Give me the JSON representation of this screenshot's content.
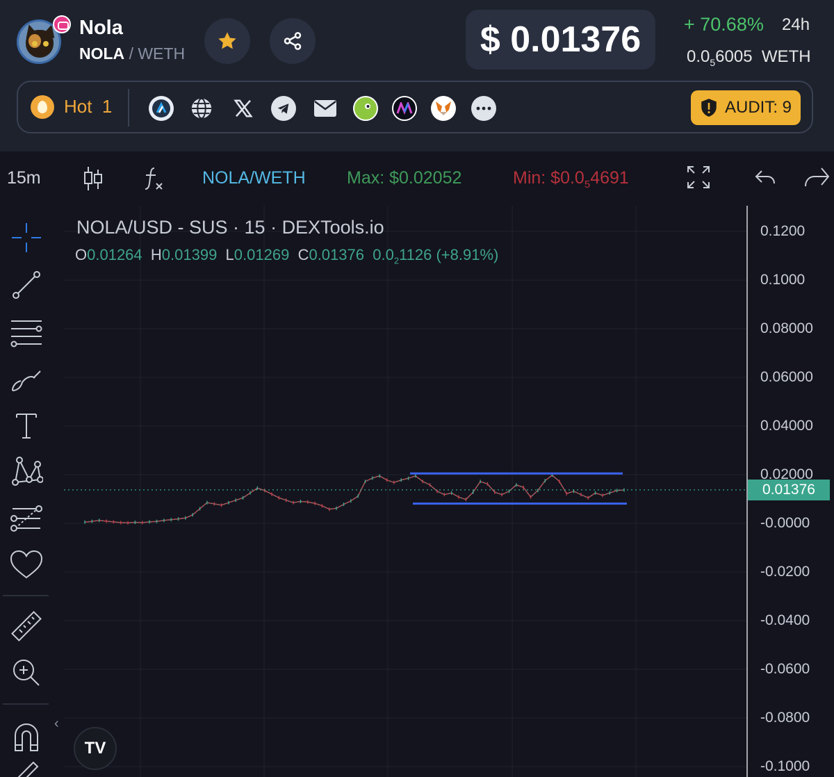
{
  "token": {
    "name": "Nola",
    "base": "NOLA",
    "separator": "/",
    "quote": "WETH",
    "logo_icon": "cat-token-logo",
    "chain_icon": "chain-badge-icon"
  },
  "price": {
    "usd": "$ 0.01376",
    "change_pct": "+ 70.68%",
    "change_period": "24h",
    "weth_prefix": "0.0",
    "weth_sub": "5",
    "weth_digits": "6005",
    "weth_unit": "WETH"
  },
  "links": {
    "hot_label": "Hot",
    "hot_rank": "1",
    "icons": [
      "arbitrum-icon",
      "website-icon",
      "x-icon",
      "telegram-icon",
      "email-icon",
      "coingecko-icon",
      "dextools-icon",
      "metamask-icon",
      "more-icon"
    ],
    "audit_label": "AUDIT: 9"
  },
  "toolbar": {
    "interval": "15m",
    "pair": "NOLA/WETH",
    "max_label": "Max: $0.02052",
    "min_prefix": "Min: $0.0",
    "min_sub": "5",
    "min_digits": "4691"
  },
  "chart": {
    "title": "NOLA/USD - SUS · 15 · DEXTools.io",
    "ohlc": {
      "o_label": "O",
      "o": "0.01264",
      "h_label": "H",
      "h": "0.01399",
      "l_label": "L",
      "l": "0.01269",
      "c_label": "C",
      "c": "0.01376",
      "chg_prefix": "0.0",
      "chg_sub": "2",
      "chg_digits": "1126",
      "chg_pct": "(+8.91%)"
    },
    "y_ticks": [
      "0.1200",
      "0.1000",
      "0.08000",
      "0.06000",
      "0.04000",
      "0.02000",
      "-0.0000",
      "-0.0200",
      "-0.0400",
      "-0.0600",
      "-0.0800",
      "-0.1000"
    ],
    "last_price": "0.01376",
    "tv_logo": "TV"
  },
  "chart_data": {
    "type": "line",
    "title": "NOLA/USD - SUS · 15 · DEXTools.io",
    "ylim": [
      -0.1,
      0.12
    ],
    "y_ticks": [
      0.12,
      0.1,
      0.08,
      0.06,
      0.04,
      0.02,
      0.0,
      -0.02,
      -0.04,
      -0.06,
      -0.08,
      -0.1
    ],
    "series": [
      {
        "values": [
          0.0005,
          0.0008,
          0.0012,
          0.0009,
          0.0006,
          0.0003,
          0.0002,
          0.0004,
          0.0003,
          0.0006,
          0.0008,
          0.0012,
          0.0015,
          0.0018,
          0.0022,
          0.0035,
          0.006,
          0.0085,
          0.008,
          0.0075,
          0.0085,
          0.0095,
          0.0105,
          0.0125,
          0.0145,
          0.0135,
          0.012,
          0.0105,
          0.0095,
          0.0085,
          0.009,
          0.0088,
          0.0082,
          0.0072,
          0.0058,
          0.0062,
          0.0078,
          0.0092,
          0.0112,
          0.0172,
          0.0186,
          0.0195,
          0.0178,
          0.0168,
          0.0178,
          0.0185,
          0.0195,
          0.0172,
          0.0158,
          0.0132,
          0.0118,
          0.0125,
          0.0108,
          0.0098,
          0.0128,
          0.0172,
          0.0162,
          0.0128,
          0.0118,
          0.0132,
          0.0158,
          0.0148,
          0.0108,
          0.0135,
          0.0175,
          0.0198,
          0.0172,
          0.0122,
          0.0132,
          0.0118,
          0.0105,
          0.0125,
          0.0115,
          0.0125,
          0.0135,
          0.0137
        ]
      }
    ],
    "annotations": [
      {
        "type": "hline",
        "y": 0.0205,
        "label": "",
        "color": "#3b63f0"
      },
      {
        "type": "hline",
        "y": 0.0081,
        "label": "",
        "color": "#3b63f0"
      },
      {
        "type": "hline",
        "y": 0.01376,
        "label": "0.01376",
        "color": "#3aa58c"
      }
    ]
  },
  "left_tools": [
    "crosshair-icon",
    "trendline-icon",
    "fib-icon",
    "brush-icon",
    "text-icon",
    "pattern-icon",
    "prediction-icon",
    "favorite-icon",
    "ruler-icon",
    "zoom-icon",
    "magnet-icon",
    "pencil-icon"
  ],
  "colors": {
    "header_bg": "#1d222d",
    "chart_bg": "#13141d",
    "up": "#4cc36a",
    "down": "#b6313c",
    "accent": "#f0b232",
    "pair_blue": "#55b9e6",
    "channel_blue": "#3b63f0",
    "last_price": "#3aa58c"
  }
}
